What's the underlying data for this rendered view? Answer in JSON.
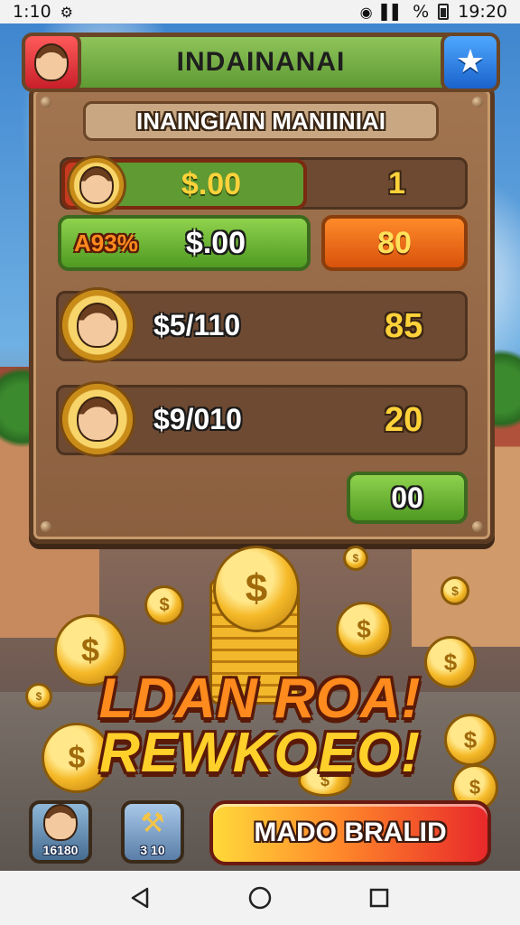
{
  "status_bar": {
    "time_left": "1:10",
    "time_right": "19:20",
    "left_icon": "notification-icon",
    "signal_text": "%"
  },
  "header": {
    "title": "INDAINANAI",
    "left_button_icon": "player-avatar-icon",
    "right_button_icon": "star-icon"
  },
  "subtitle": "INAINGIAIN MANIINIAI",
  "rows": {
    "row1": {
      "amount": "$.00",
      "value": "1"
    },
    "row2": {
      "badge": "A93%",
      "amount": "$.00",
      "value": "80"
    },
    "row3": {
      "amount": "$5/110",
      "value": "85"
    },
    "row4": {
      "amount": "$9/010",
      "value": "20"
    }
  },
  "panel_button": {
    "label": "00"
  },
  "banner": {
    "line1": "LDAN ROA!",
    "line2": "REWKOEO!"
  },
  "coin_symbol": "$",
  "bottom": {
    "btn1_label": "16180",
    "btn2_label": "3 10",
    "cta_label": "MADO BRALID"
  },
  "colors": {
    "accent_green": "#5e9a33",
    "accent_orange": "#d8520b",
    "accent_yellow": "#ffd23a",
    "wood": "#8a5f3f"
  }
}
